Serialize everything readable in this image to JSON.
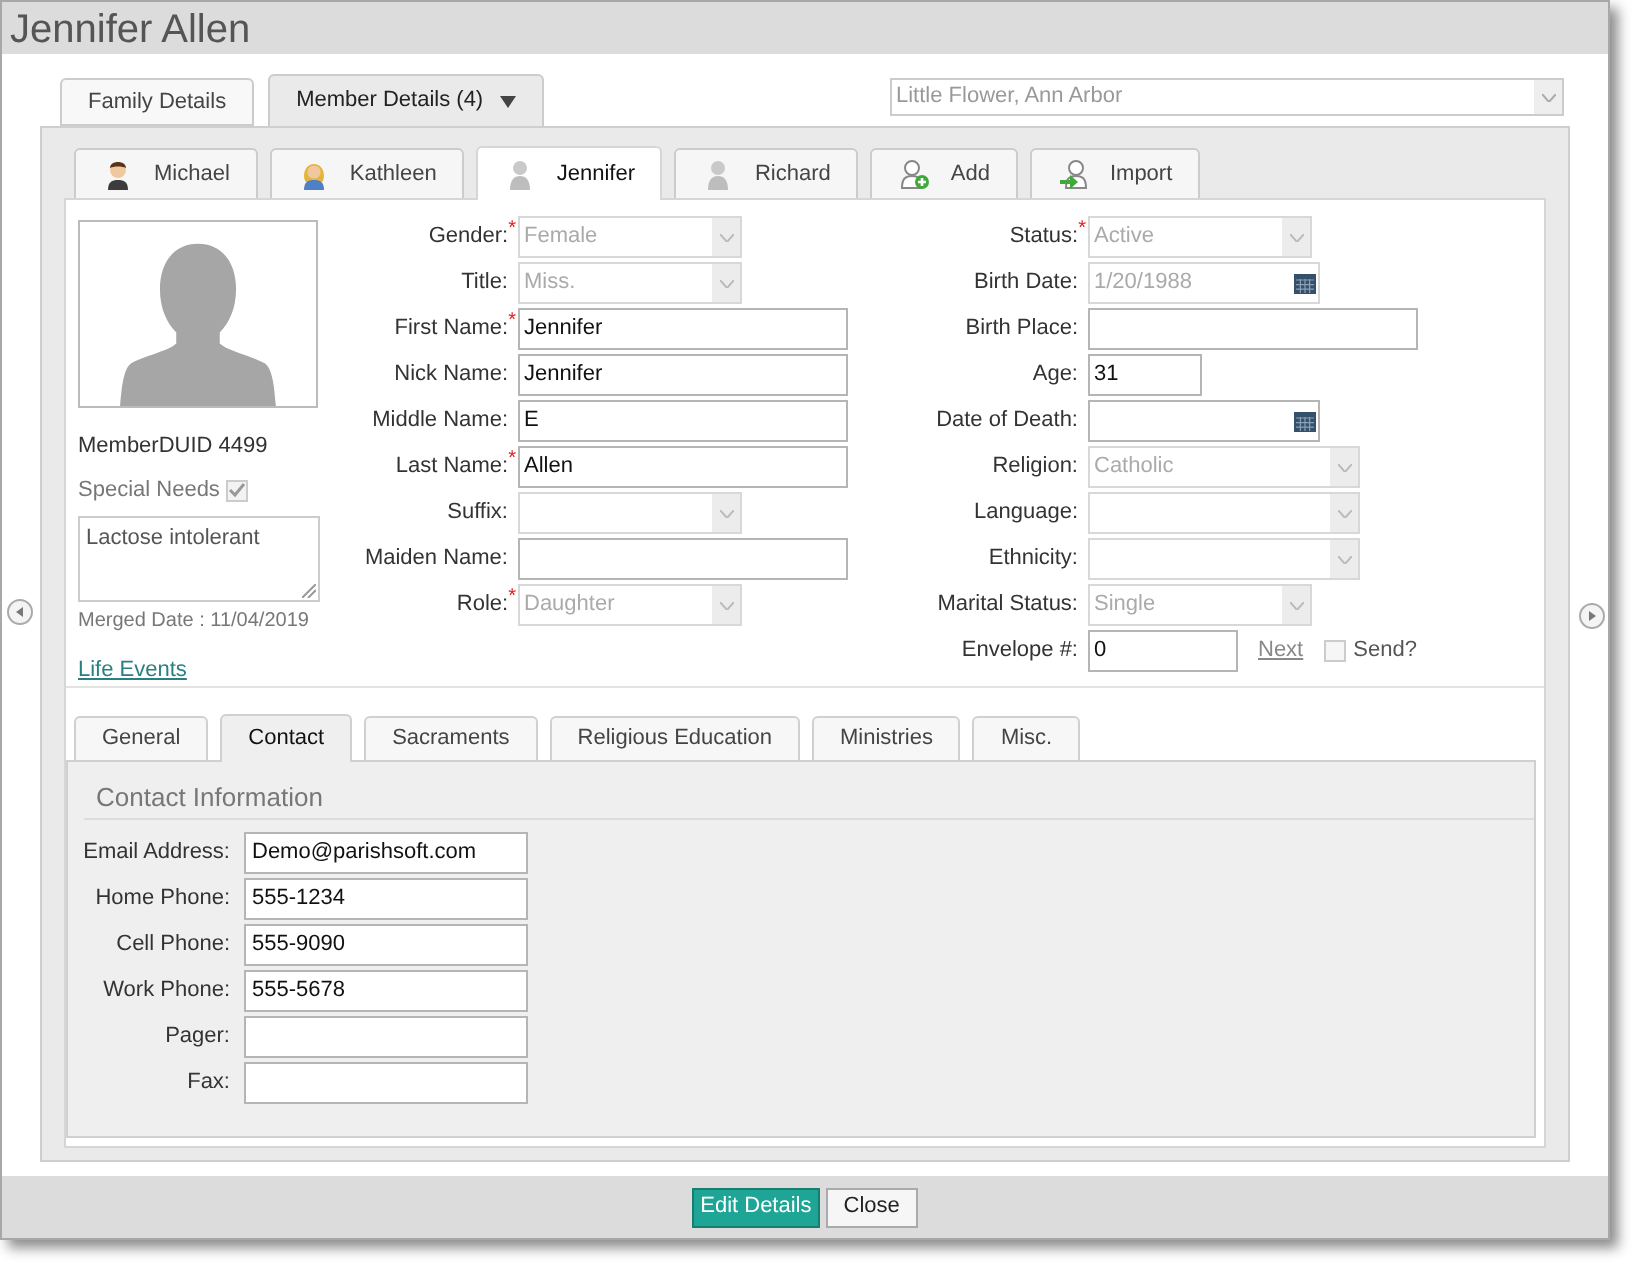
{
  "window": {
    "title": "Jennifer Allen"
  },
  "top_tabs": [
    {
      "label": "Family Details",
      "selected": false,
      "dropdown": false
    },
    {
      "label": "Member Details (4)",
      "selected": true,
      "dropdown": true
    }
  ],
  "parish_select": {
    "value": "Little Flower, Ann Arbor"
  },
  "member_tabs": [
    {
      "label": "Michael",
      "kind": "man",
      "selected": false
    },
    {
      "label": "Kathleen",
      "kind": "woman",
      "selected": false
    },
    {
      "label": "Jennifer",
      "kind": "person",
      "selected": true
    },
    {
      "label": "Richard",
      "kind": "person",
      "selected": false
    },
    {
      "label": "Add",
      "kind": "add",
      "selected": false
    },
    {
      "label": "Import",
      "kind": "import",
      "selected": false
    }
  ],
  "profile": {
    "member_duid": "MemberDUID 4499",
    "special_needs": {
      "label": "Special Needs",
      "checked": true
    },
    "notes": "Lactose intolerant",
    "merged_date": "Merged Date : 11/04/2019",
    "link": "Life Events"
  },
  "left_fields": [
    {
      "label": "Gender:",
      "kind": "select",
      "required_mark": "*",
      "disabled": true,
      "value": "Female"
    },
    {
      "label": "Title:",
      "kind": "select",
      "disabled": true,
      "value": "Miss."
    },
    {
      "label": "First Name:",
      "kind": "text",
      "required_mark": "*",
      "disabled": false,
      "value": "Jennifer"
    },
    {
      "label": "Nick Name:",
      "kind": "text",
      "disabled": false,
      "value": "Jennifer"
    },
    {
      "label": "Middle Name:",
      "kind": "text",
      "disabled": false,
      "value": "E"
    },
    {
      "label": "Last Name:",
      "kind": "text",
      "required_mark": "*",
      "disabled": false,
      "value": "Allen"
    },
    {
      "label": "Suffix:",
      "kind": "select",
      "disabled": true
    },
    {
      "label": "Maiden Name:",
      "kind": "text",
      "disabled": false
    },
    {
      "label": "Role:",
      "kind": "select",
      "required_mark": "*",
      "disabled": true,
      "value": "Daughter"
    }
  ],
  "right_fields": [
    {
      "label": "Status:",
      "kind": "select",
      "required_mark": "*",
      "disabled": true,
      "value": "Active"
    },
    {
      "label": "Birth Date:",
      "kind": "date",
      "disabled": true,
      "value": "1/20/1988"
    },
    {
      "label": "Birth Place:",
      "kind": "text",
      "disabled": false
    },
    {
      "label": "Age:",
      "kind": "short",
      "disabled": false,
      "value": "31"
    },
    {
      "label": "Date of Death:",
      "kind": "date",
      "disabled": false
    },
    {
      "label": "Religion:",
      "kind": "wideselect",
      "disabled": true,
      "value": "Catholic"
    },
    {
      "label": "Language:",
      "kind": "wideselect",
      "disabled": true
    },
    {
      "label": "Ethnicity:",
      "kind": "wideselect",
      "disabled": true
    },
    {
      "label": "Marital Status:",
      "kind": "select",
      "disabled": true,
      "value": "Single"
    },
    {
      "label": "Envelope #:",
      "kind": "envelope",
      "disabled": false,
      "value": "0",
      "link": "Next",
      "checkbox": {
        "label": "Send?",
        "checked": false
      }
    }
  ],
  "section_tabs": [
    {
      "label": "General",
      "selected": false
    },
    {
      "label": "Contact",
      "selected": true
    },
    {
      "label": "Sacraments",
      "selected": false
    },
    {
      "label": "Religious Education",
      "selected": false
    },
    {
      "label": "Ministries",
      "selected": false
    },
    {
      "label": "Misc.",
      "selected": false
    }
  ],
  "contact": {
    "heading": "Contact Information",
    "fields": [
      {
        "label": "Email Address:",
        "value": "Demo@parishsoft.com"
      },
      {
        "label": "Home Phone:",
        "value": "555-1234"
      },
      {
        "label": "Cell Phone:",
        "value": "555-9090"
      },
      {
        "label": "Work Phone:",
        "value": "555-5678"
      },
      {
        "label": "Pager:"
      },
      {
        "label": "Fax:"
      }
    ]
  },
  "buttons": [
    {
      "label": "Edit Details",
      "kind": "primary"
    },
    {
      "label": "Close",
      "kind": "default"
    }
  ]
}
